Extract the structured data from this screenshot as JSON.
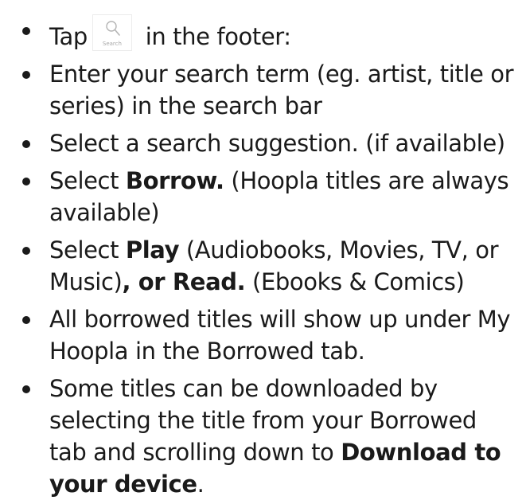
{
  "steps": [
    {
      "before": "Tap",
      "icon_label": "Search",
      "after": " in the footer:"
    },
    {
      "text": "Enter your search term (eg. artist, title or series) in the search bar"
    },
    {
      "text": "Select a search suggestion. (if available)"
    },
    {
      "a": "Select ",
      "b": "Borrow.",
      "c": " (Hoopla titles are always available)"
    },
    {
      "a": "Select ",
      "b": "Play",
      "c": " (Audiobooks, Movies, TV, or Music)",
      "d": ", or ",
      "e": "Read.",
      "f": " (Ebooks & Comics)"
    },
    {
      "text": "All borrowed titles will show up under My Hoopla in the Borrowed tab."
    },
    {
      "a": "Some titles can be downloaded by selecting the title from your Borrowed tab and scrolling down to ",
      "b": "Download to your device",
      "c": "."
    }
  ],
  "icons": {
    "search": "magnifier-icon"
  }
}
